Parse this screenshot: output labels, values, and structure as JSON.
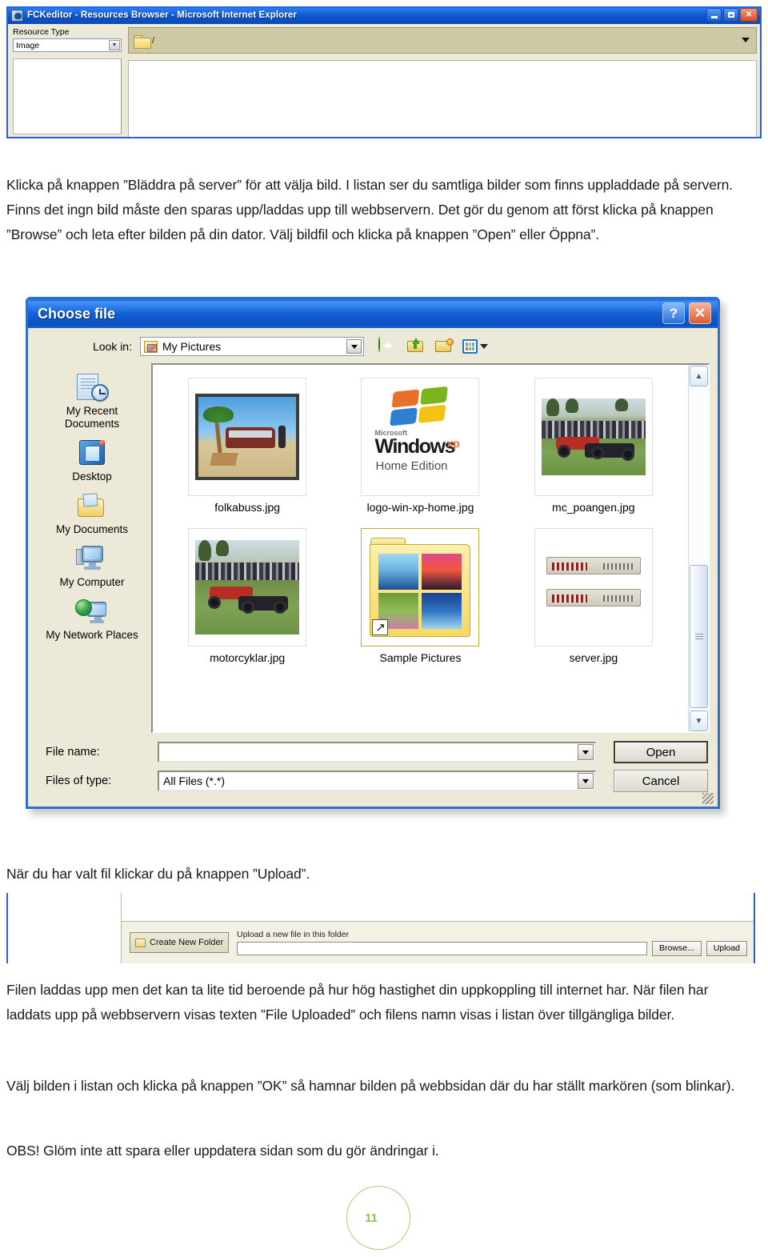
{
  "ie_window": {
    "title": "FCKeditor - Resources Browser - Microsoft Internet Explorer",
    "resource_type_label": "Resource Type",
    "resource_type_value": "Image",
    "path_value": "/",
    "window_buttons": {
      "minimize": "_",
      "maximize": "□",
      "close": "✕"
    }
  },
  "paragraphs": {
    "intro": "Klicka på knappen ”Bläddra på server” för att välja bild. I listan ser du samtliga bilder som finns uppladdade på servern. Finns det ingn bild måste den sparas upp/laddas upp till webbservern. Det gör du genom att först klicka på knappen ”Browse” och leta efter bilden på din dator. Välj bildfil och klicka på knappen ”Open” eller Öppna”.",
    "mid": "När du har valt fil klickar du på knappen ”Upload”.",
    "upload": "Filen laddas upp men det kan ta lite tid beroende på hur hög hastighet din uppkoppling till internet har. När filen har laddats upp på webbservern visas texten ”File Uploaded” och filens namn visas i listan över tillgängliga bilder.",
    "ok": "Välj bilden i listan och klicka på knappen ”OK” så hamnar bilden på webbsidan där du har ställt markören (som blinkar).",
    "obs": "OBS! Glöm inte att spara eller uppdatera sidan som du gör ändringar i."
  },
  "choose_file_dialog": {
    "title": "Choose file",
    "help_button": "?",
    "close_button": "✕",
    "lookin_label": "Look in:",
    "lookin_value": "My Pictures",
    "toolbar": [
      "back-icon",
      "up-one-level-icon",
      "new-folder-icon",
      "views-icon"
    ],
    "places": [
      {
        "label": "My Recent Documents",
        "icon": "recent-documents-icon"
      },
      {
        "label": "Desktop",
        "icon": "desktop-icon"
      },
      {
        "label": "My Documents",
        "icon": "my-documents-icon"
      },
      {
        "label": "My Computer",
        "icon": "my-computer-icon"
      },
      {
        "label": "My Network Places",
        "icon": "my-network-places-icon"
      }
    ],
    "files": [
      {
        "name": "folkabuss.jpg",
        "type": "image"
      },
      {
        "name": "logo-win-xp-home.jpg",
        "type": "image"
      },
      {
        "name": "mc_poangen.jpg",
        "type": "image"
      },
      {
        "name": "motorcyklar.jpg",
        "type": "image"
      },
      {
        "name": "Sample Pictures",
        "type": "folder-shortcut"
      },
      {
        "name": "server.jpg",
        "type": "image"
      }
    ],
    "xp_logo": {
      "microsoft": "Microsoft",
      "windows": "Windows",
      "xp": "xp",
      "edition": "Home Edition"
    },
    "filename_label": "File name:",
    "filename_value": "",
    "filetype_label": "Files of type:",
    "filetype_value": "All Files (*.*)",
    "open_button": "Open",
    "cancel_button": "Cancel"
  },
  "upload_strip": {
    "create_folder_button": "Create New Folder",
    "upload_label": "Upload a new file in this folder",
    "upload_value": "",
    "browse_button": "Browse...",
    "upload_button": "Upload"
  },
  "footer": {
    "page_number": "11"
  },
  "colors": {
    "title_blue": "#0e56cf",
    "dialog_border": "#2f6fd0",
    "panel_beige": "#ece9d8",
    "path_olive": "#cdc9a5",
    "page_green": "#8ec63f",
    "circle_green": "#a8cf74"
  }
}
